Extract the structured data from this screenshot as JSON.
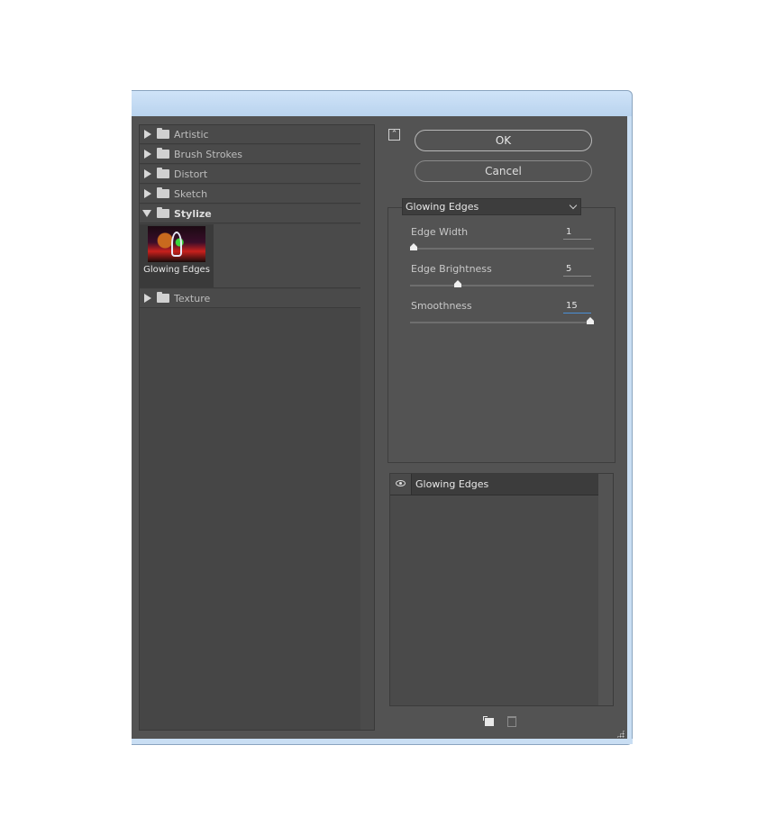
{
  "gallery": {
    "categories": [
      {
        "label": "Artistic",
        "expanded": false
      },
      {
        "label": "Brush Strokes",
        "expanded": false
      },
      {
        "label": "Distort",
        "expanded": false
      },
      {
        "label": "Sketch",
        "expanded": false
      },
      {
        "label": "Stylize",
        "expanded": true
      },
      {
        "label": "Texture",
        "expanded": false
      }
    ],
    "stylize_items": [
      {
        "label": "Glowing Edges",
        "selected": true
      }
    ]
  },
  "buttons": {
    "ok": "OK",
    "cancel": "Cancel"
  },
  "filter": {
    "selected": "Glowing Edges",
    "params": [
      {
        "label": "Edge Width",
        "value": "1",
        "fraction": 0.0
      },
      {
        "label": "Edge Brightness",
        "value": "5",
        "fraction": 0.25
      },
      {
        "label": "Smoothness",
        "value": "15",
        "fraction": 1.0
      }
    ]
  },
  "layers": {
    "items": [
      {
        "name": "Glowing Edges",
        "visible": true
      }
    ]
  },
  "icons": {
    "collapse": "collapse-icon",
    "eye": "eye-icon",
    "new_layer": "new-layer-icon",
    "trash": "trash-icon",
    "folder": "folder-icon"
  }
}
